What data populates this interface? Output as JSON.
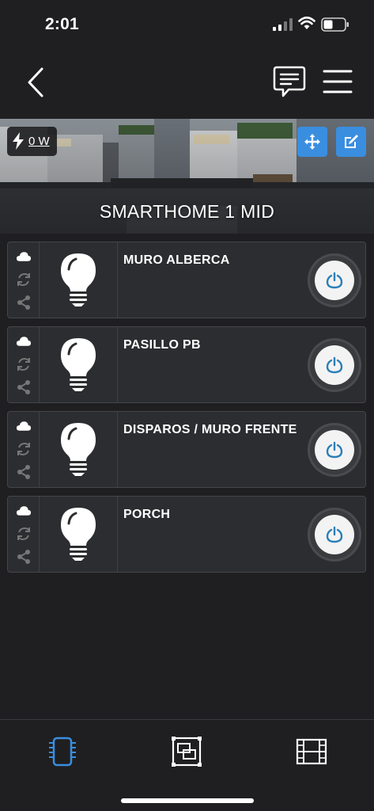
{
  "status_bar": {
    "time": "2:01"
  },
  "header": {
    "back_icon": "chevron-left-icon",
    "chat_icon": "chat-icon",
    "menu_icon": "hamburger-menu-icon"
  },
  "hero": {
    "power_value": "0 W",
    "title": "SMARTHOME 1 MID",
    "move_icon": "move-arrows-icon",
    "edit_icon": "edit-icon"
  },
  "devices": [
    {
      "name": "MURO ALBERCA"
    },
    {
      "name": "PASILLO PB"
    },
    {
      "name": "DISPAROS / MURO FRENTE"
    },
    {
      "name": "PORCH"
    }
  ],
  "tabs": [
    {
      "icon": "device-chip-icon",
      "active": true
    },
    {
      "icon": "scene-frames-icon",
      "active": false
    },
    {
      "icon": "film-strip-icon",
      "active": false
    }
  ],
  "colors": {
    "accent": "#3a8ee0",
    "background": "#1f1f21",
    "card": "#2c2d30",
    "power_icon": "#2a7fb8"
  }
}
